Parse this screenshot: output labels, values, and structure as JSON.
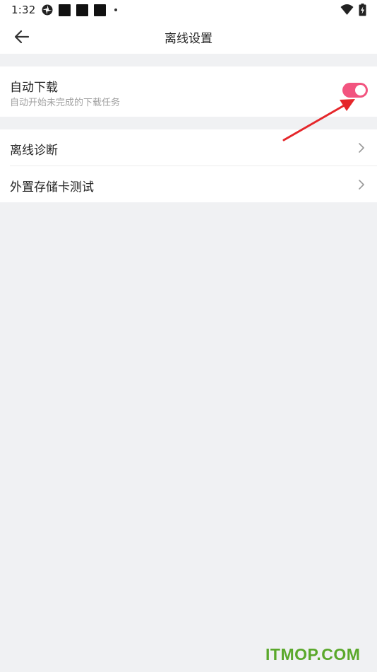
{
  "status_bar": {
    "time": "1:32",
    "icons": [
      "settings-gear-icon",
      "notification-icon",
      "notification-icon",
      "notification-icon",
      "more-dot-icon",
      "wifi-icon",
      "battery-icon"
    ]
  },
  "header": {
    "title": "离线设置",
    "back_icon": "arrow-left-icon"
  },
  "auto_download": {
    "title": "自动下载",
    "subtitle": "自动开始未完成的下载任务",
    "enabled": true,
    "toggle_color": "#f2547f"
  },
  "menu": {
    "items": [
      {
        "label": "离线诊断",
        "icon": "chevron-right-icon"
      },
      {
        "label": "外置存储卡测试",
        "icon": "chevron-right-icon"
      }
    ]
  },
  "annotation": {
    "arrow_color": "#e5262a"
  },
  "watermark": {
    "text": "ITMOP.COM",
    "color": "#5aa82b"
  }
}
